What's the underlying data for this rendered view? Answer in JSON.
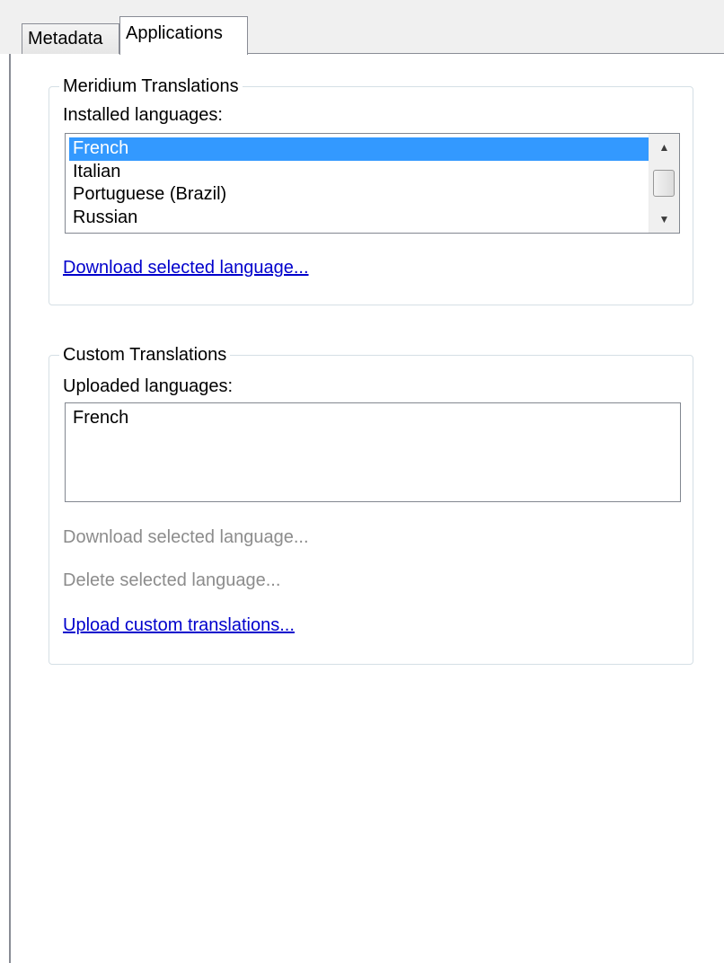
{
  "tabs": [
    {
      "label": "Metadata",
      "active": false
    },
    {
      "label": "Applications",
      "active": true
    }
  ],
  "meridium": {
    "group_title": "Meridium Translations",
    "list_label": "Installed languages:",
    "languages": [
      "French",
      "Italian",
      "Portuguese (Brazil)",
      "Russian"
    ],
    "selected": "French",
    "download_link": "Download selected language..."
  },
  "custom": {
    "group_title": "Custom Translations",
    "list_label": "Uploaded languages:",
    "languages": [
      "French"
    ],
    "download_link": "Download selected language...",
    "delete_link": "Delete selected language...",
    "upload_link": "Upload custom translations..."
  },
  "colors": {
    "selection": "#3399ff",
    "link": "#0000cc",
    "disabled_text": "#8c8c8c",
    "group_border": "#d5dfe5"
  },
  "icons": {
    "scroll_up": "scroll-up-arrow-icon",
    "scroll_down": "scroll-down-arrow-icon"
  }
}
